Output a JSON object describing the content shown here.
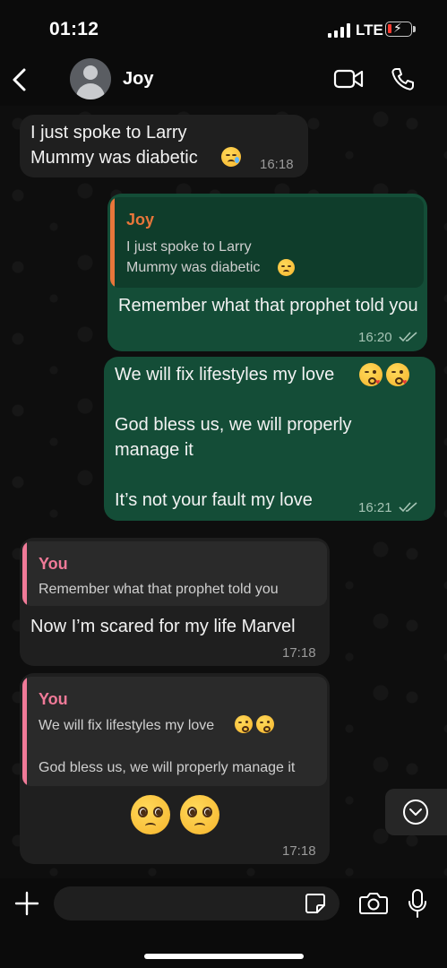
{
  "status_bar": {
    "time": "01:12",
    "network": "LTE"
  },
  "header": {
    "contact_name": "Joy"
  },
  "messages": [
    {
      "direction": "incoming",
      "text": "I just spoke to Larry\nMummy was diabetic",
      "emoji": "downcast-face",
      "time": "16:18"
    },
    {
      "direction": "outgoing",
      "quote": {
        "author": "Joy",
        "text": "I just spoke to Larry\nMummy was diabetic"
      },
      "text": "Remember what that prophet told you",
      "time": "16:20"
    },
    {
      "direction": "outgoing",
      "lines": [
        "We will fix lifestyles my love",
        "God bless us, we will properly manage it",
        "It’s not your fault my love"
      ],
      "time": "16:21"
    },
    {
      "direction": "incoming",
      "quote": {
        "author": "You",
        "text": "Remember what that prophet told you"
      },
      "text": "Now I’m scared for my life Marvel",
      "time": "17:18"
    },
    {
      "direction": "incoming",
      "quote": {
        "author": "You",
        "line1": "We will fix lifestyles my love",
        "line2": "God bless us, we will properly manage it"
      },
      "emojis": [
        "pleading-face",
        "pleading-face"
      ],
      "time": "17:18"
    }
  ],
  "composer": {
    "placeholder": ""
  },
  "colors": {
    "outgoing_bubble": "#144d37",
    "incoming_bubble": "#1f1f1f",
    "joy_quote_accent": "#e8763a",
    "you_quote_accent": "#f07a98"
  },
  "icons": [
    "back-chevron",
    "contact-avatar",
    "video-camera",
    "phone",
    "chevron-down",
    "plus",
    "sticker",
    "camera",
    "microphone"
  ]
}
